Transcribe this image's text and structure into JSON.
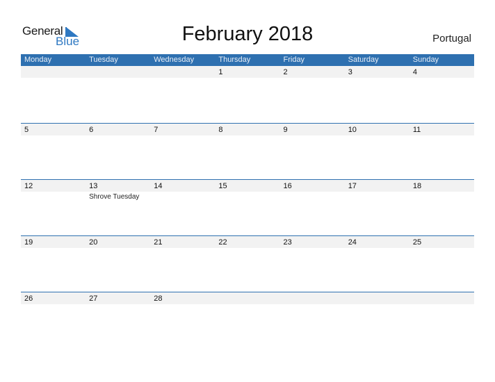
{
  "logo": {
    "text_general": "General",
    "text_blue": "Blue"
  },
  "title": "February 2018",
  "country": "Portugal",
  "colors": {
    "accent": "#2e70b0",
    "strip": "#f2f2f2"
  },
  "weekdays": [
    "Monday",
    "Tuesday",
    "Wednesday",
    "Thursday",
    "Friday",
    "Saturday",
    "Sunday"
  ],
  "weeks": [
    [
      {
        "day": ""
      },
      {
        "day": ""
      },
      {
        "day": ""
      },
      {
        "day": "1"
      },
      {
        "day": "2"
      },
      {
        "day": "3"
      },
      {
        "day": "4"
      }
    ],
    [
      {
        "day": "5"
      },
      {
        "day": "6"
      },
      {
        "day": "7"
      },
      {
        "day": "8"
      },
      {
        "day": "9"
      },
      {
        "day": "10"
      },
      {
        "day": "11"
      }
    ],
    [
      {
        "day": "12"
      },
      {
        "day": "13",
        "event": "Shrove Tuesday"
      },
      {
        "day": "14"
      },
      {
        "day": "15"
      },
      {
        "day": "16"
      },
      {
        "day": "17"
      },
      {
        "day": "18"
      }
    ],
    [
      {
        "day": "19"
      },
      {
        "day": "20"
      },
      {
        "day": "21"
      },
      {
        "day": "22"
      },
      {
        "day": "23"
      },
      {
        "day": "24"
      },
      {
        "day": "25"
      }
    ],
    [
      {
        "day": "26"
      },
      {
        "day": "27"
      },
      {
        "day": "28"
      },
      {
        "day": ""
      },
      {
        "day": ""
      },
      {
        "day": ""
      },
      {
        "day": ""
      }
    ]
  ]
}
